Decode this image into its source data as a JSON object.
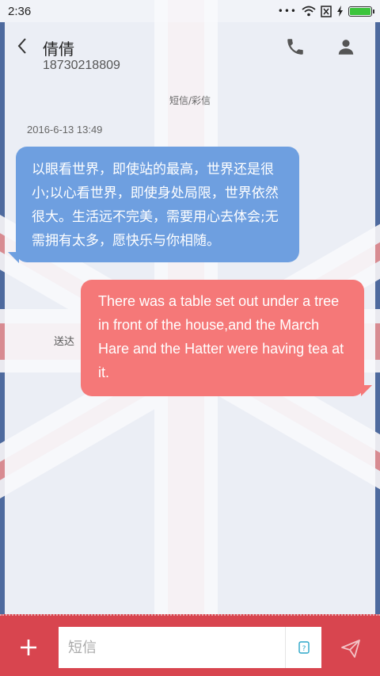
{
  "status_bar": {
    "time": "2:36",
    "signal_dots": "•••"
  },
  "header": {
    "contact_name": "倩倩",
    "contact_number": "18730218809"
  },
  "conversation": {
    "channel_label": "短信/彩信",
    "timestamp": "2016-6-13 13:49",
    "incoming_message": "以眼看世界，即使站的最高，世界还是很小;以心看世界，即使身处局限，世界依然很大。生活远不完美，需要用心去体会;无需拥有太多，愿快乐与你相随。",
    "outgoing_message": "There was a table set out under a tree in front of the house,and the March Hare and the Hatter were having tea at it.",
    "delivered_label": "送达"
  },
  "composer": {
    "placeholder": "短信",
    "sim_label": "?"
  },
  "colors": {
    "incoming_bubble": "#6e9fe0",
    "outgoing_bubble": "#f57878",
    "bottom_bar": "#d8454f",
    "battery": "#3cc43c"
  }
}
